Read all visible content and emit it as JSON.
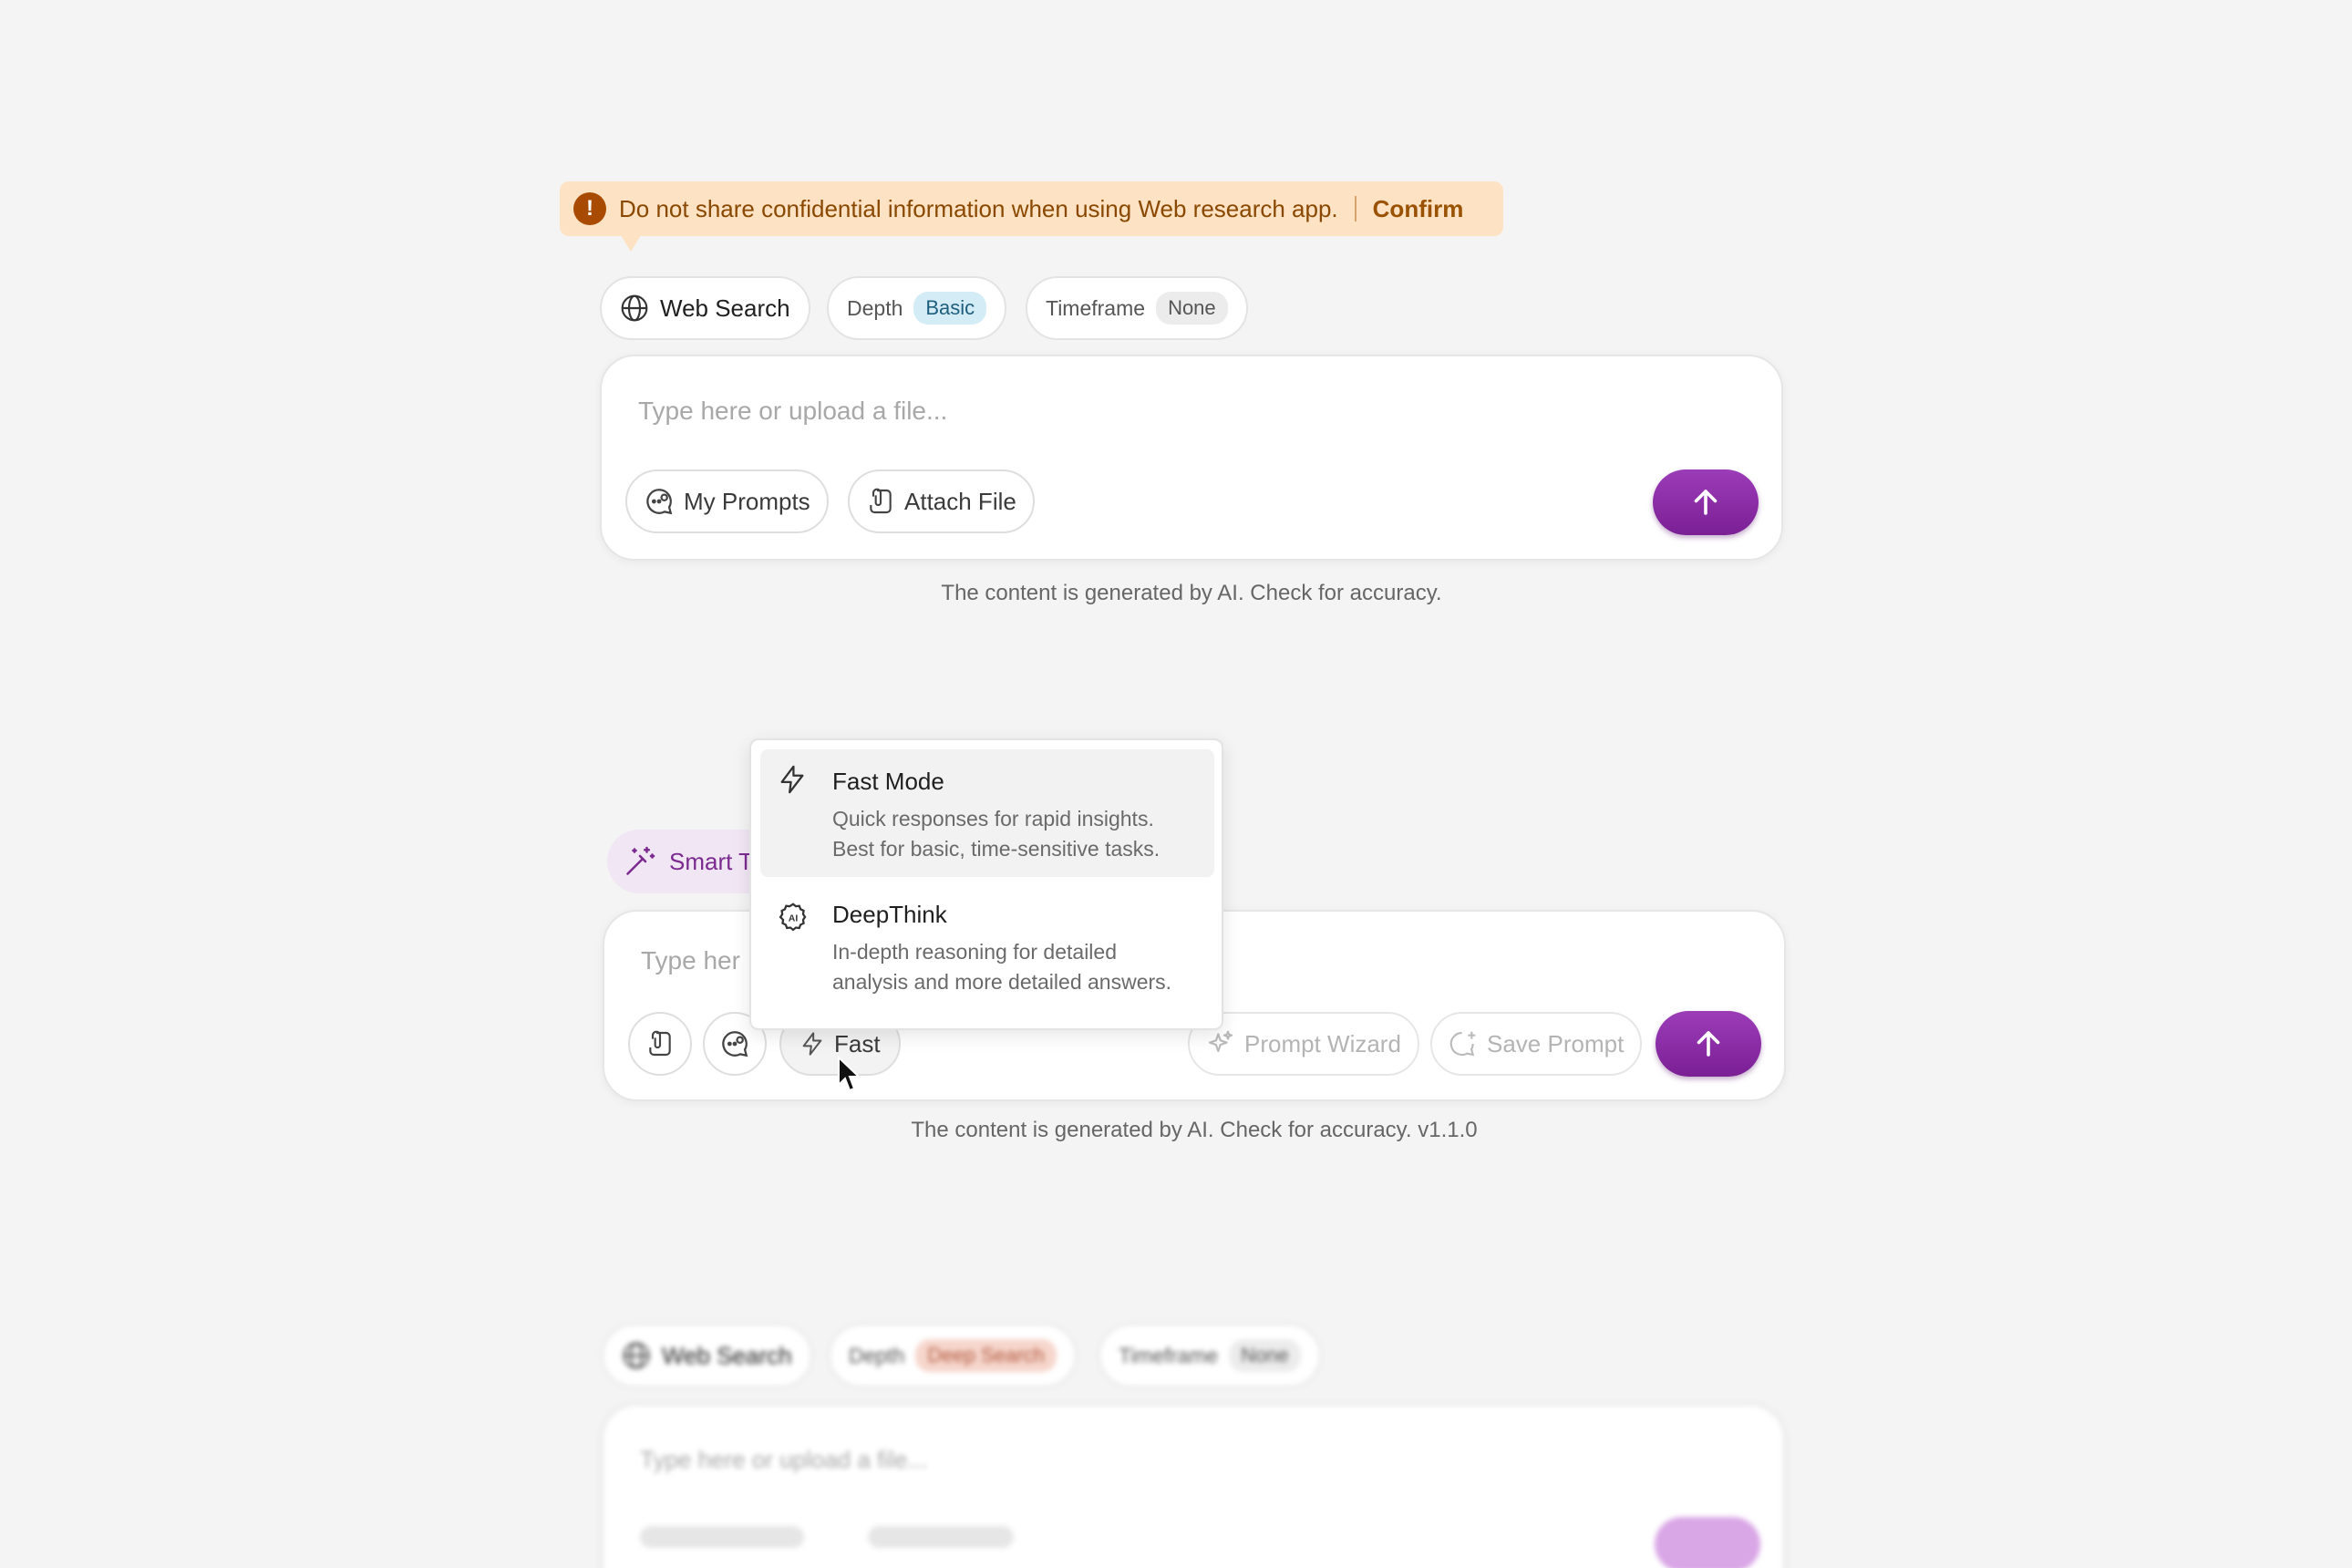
{
  "banner": {
    "text": "Do not share confidential information when using Web research app.",
    "confirm": "Confirm"
  },
  "composer1": {
    "chips": {
      "web_search": "Web Search",
      "depth_label": "Depth",
      "depth_value": "Basic",
      "timeframe_label": "Timeframe",
      "timeframe_value": "None"
    },
    "placeholder": "Type here or upload a file...",
    "my_prompts": "My Prompts",
    "attach_file": "Attach File",
    "footer": "The content is generated by AI. Check for accuracy."
  },
  "composer2": {
    "smart_tab": "Smart T",
    "placeholder": "Type her",
    "mode_button": "Fast",
    "prompt_wizard": "Prompt Wizard",
    "save_prompt": "Save Prompt",
    "footer": "The content is generated by AI. Check for accuracy. v1.1.0"
  },
  "mode_menu": {
    "items": [
      {
        "title": "Fast Mode",
        "desc_line1": "Quick responses for rapid insights.",
        "desc_line2": "Best for basic, time-sensitive tasks.",
        "icon": "lightning-icon",
        "active": true
      },
      {
        "title": "DeepThink",
        "desc_line1": "In-depth reasoning for detailed",
        "desc_line2": "analysis and more detailed answers.",
        "icon": "ai-brain-icon",
        "active": false
      }
    ]
  },
  "composer3": {
    "chips": {
      "web_search": "Web Search",
      "depth_label": "Depth",
      "depth_value": "Deep Search",
      "timeframe_label": "Timeframe",
      "timeframe_value": "None"
    },
    "placeholder": "Type here or upload a file..."
  },
  "colors": {
    "accent_purple": "#8a2ba6",
    "banner_bg": "#fde2c4",
    "depth_basic_bg": "#d4ecf6",
    "depth_deep_bg": "#f6d6cc"
  }
}
